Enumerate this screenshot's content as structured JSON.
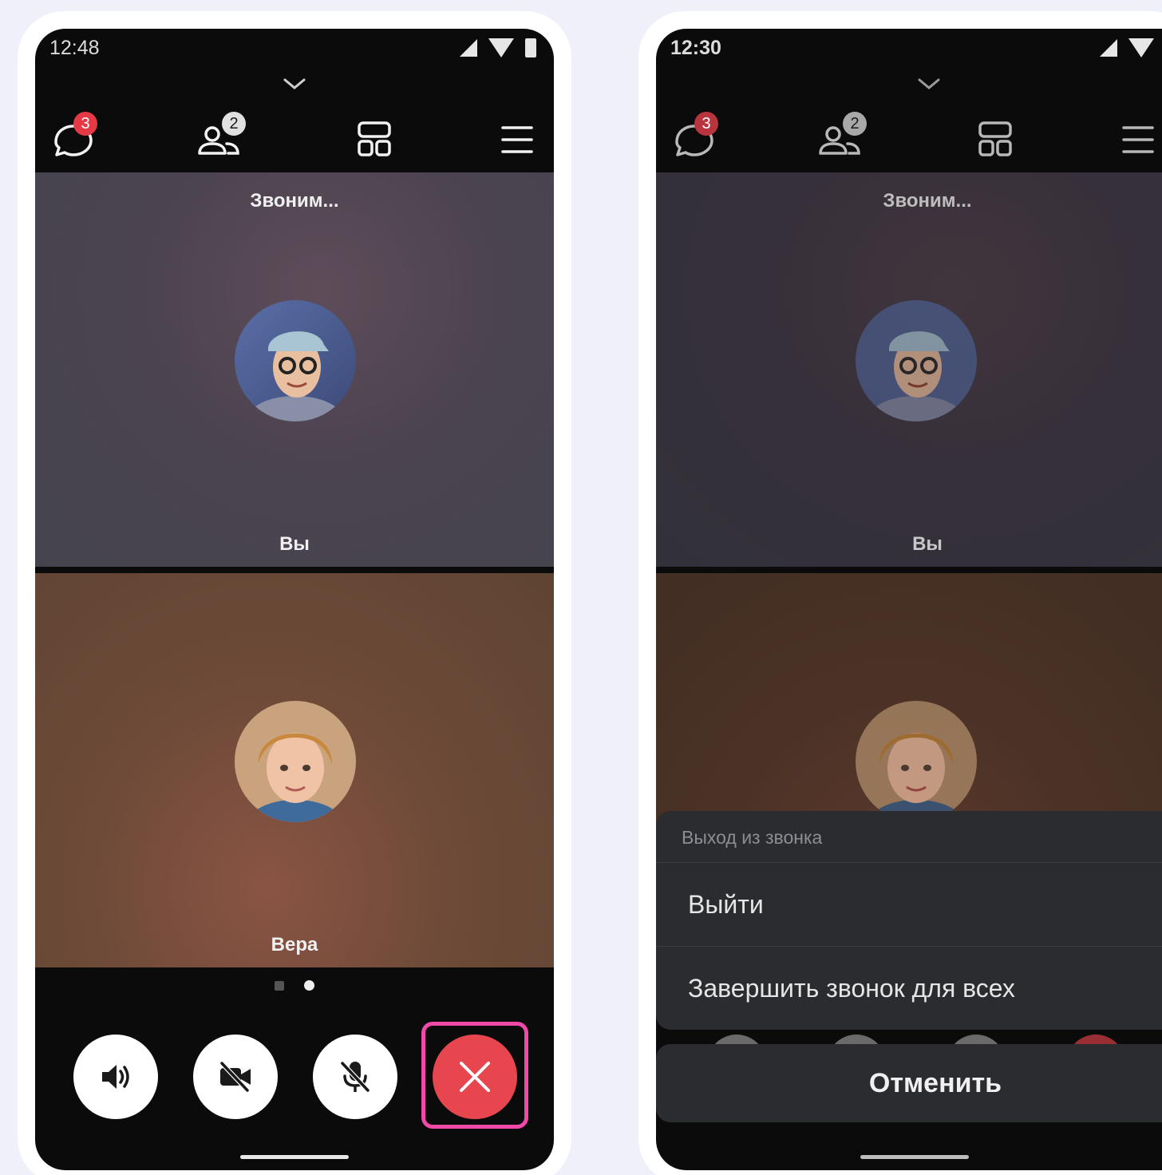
{
  "screens": [
    {
      "time": "12:48",
      "chat_badge": "3",
      "participants_badge": "2",
      "calling_status": "Звоним...",
      "tiles": [
        {
          "name": "Вы",
          "bg": "#4b4350"
        },
        {
          "name": "Вера",
          "bg": "#6e4a38"
        }
      ],
      "pager": {
        "pages": 2,
        "active": 2
      },
      "highlight_color": "#f049a8",
      "hangup_color": "#e8464f"
    },
    {
      "time": "12:30",
      "chat_badge": "3",
      "participants_badge": "2",
      "calling_status": "Звоним...",
      "tiles": [
        {
          "name": "Вы"
        },
        {
          "name": ""
        }
      ],
      "exit_sheet": {
        "title": "Выход из звонка",
        "options": [
          "Выйти",
          "Завершить звонок для всех"
        ],
        "cancel": "Отменить"
      }
    }
  ],
  "icons": [
    "chevron-down-icon",
    "chat-icon",
    "participants-icon",
    "layout-grid-icon",
    "menu-icon",
    "speaker-icon",
    "camera-off-icon",
    "mic-off-icon",
    "close-icon"
  ]
}
